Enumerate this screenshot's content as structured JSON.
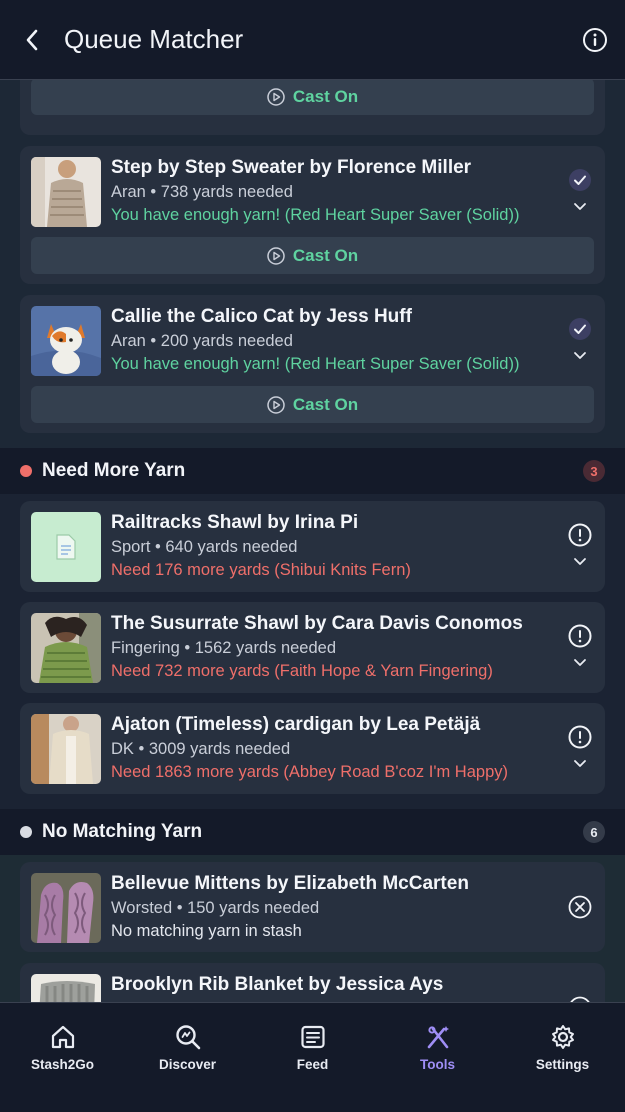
{
  "header": {
    "title": "Queue Matcher"
  },
  "cast_on_label": "Cast On",
  "ready_projects": [
    {
      "title": "Step by Step Sweater by Florence Miller",
      "subtitle": "Aran • 738 yards needed",
      "status": "You have enough yarn! (Red Heart Super Saver (Solid))"
    },
    {
      "title": "Callie the Calico Cat by Jess Huff",
      "subtitle": "Aran • 200 yards needed",
      "status": "You have enough yarn! (Red Heart Super Saver (Solid))"
    }
  ],
  "need_more": {
    "label": "Need More Yarn",
    "count": "3",
    "dot_color": "#ef6f6a",
    "items": [
      {
        "title": "Railtracks Shawl by Irina Pi",
        "subtitle": "Sport • 640 yards needed",
        "status": "Need 176 more yards (Shibui Knits Fern)"
      },
      {
        "title": "The Susurrate Shawl by Cara Davis Conomos",
        "subtitle": "Fingering • 1562 yards needed",
        "status": "Need 732 more yards (Faith Hope & Yarn Fingering)"
      },
      {
        "title": "Ajaton (Timeless) cardigan by Lea Petäjä",
        "subtitle": "DK • 3009 yards needed",
        "status": "Need 1863 more yards (Abbey Road B'coz I'm Happy)"
      }
    ]
  },
  "no_match": {
    "label": "No Matching Yarn",
    "count": "6",
    "dot_color": "#d9dce3",
    "items": [
      {
        "title": "Bellevue Mittens by Elizabeth McCarten",
        "subtitle": "Worsted • 150 yards needed",
        "status": "No matching yarn in stash"
      },
      {
        "title": "Brooklyn Rib Blanket by Jessica Ays"
      }
    ]
  },
  "tabs": [
    {
      "label": "Stash2Go",
      "icon": "home-icon"
    },
    {
      "label": "Discover",
      "icon": "discover-search-icon"
    },
    {
      "label": "Feed",
      "icon": "feed-icon"
    },
    {
      "label": "Tools",
      "icon": "tools-icon",
      "active": true
    },
    {
      "label": "Settings",
      "icon": "gear-icon"
    }
  ],
  "colors": {
    "accent_green": "#5fd3a0",
    "need_red": "#ef6f6a",
    "active_tab": "#9f8ef5"
  }
}
